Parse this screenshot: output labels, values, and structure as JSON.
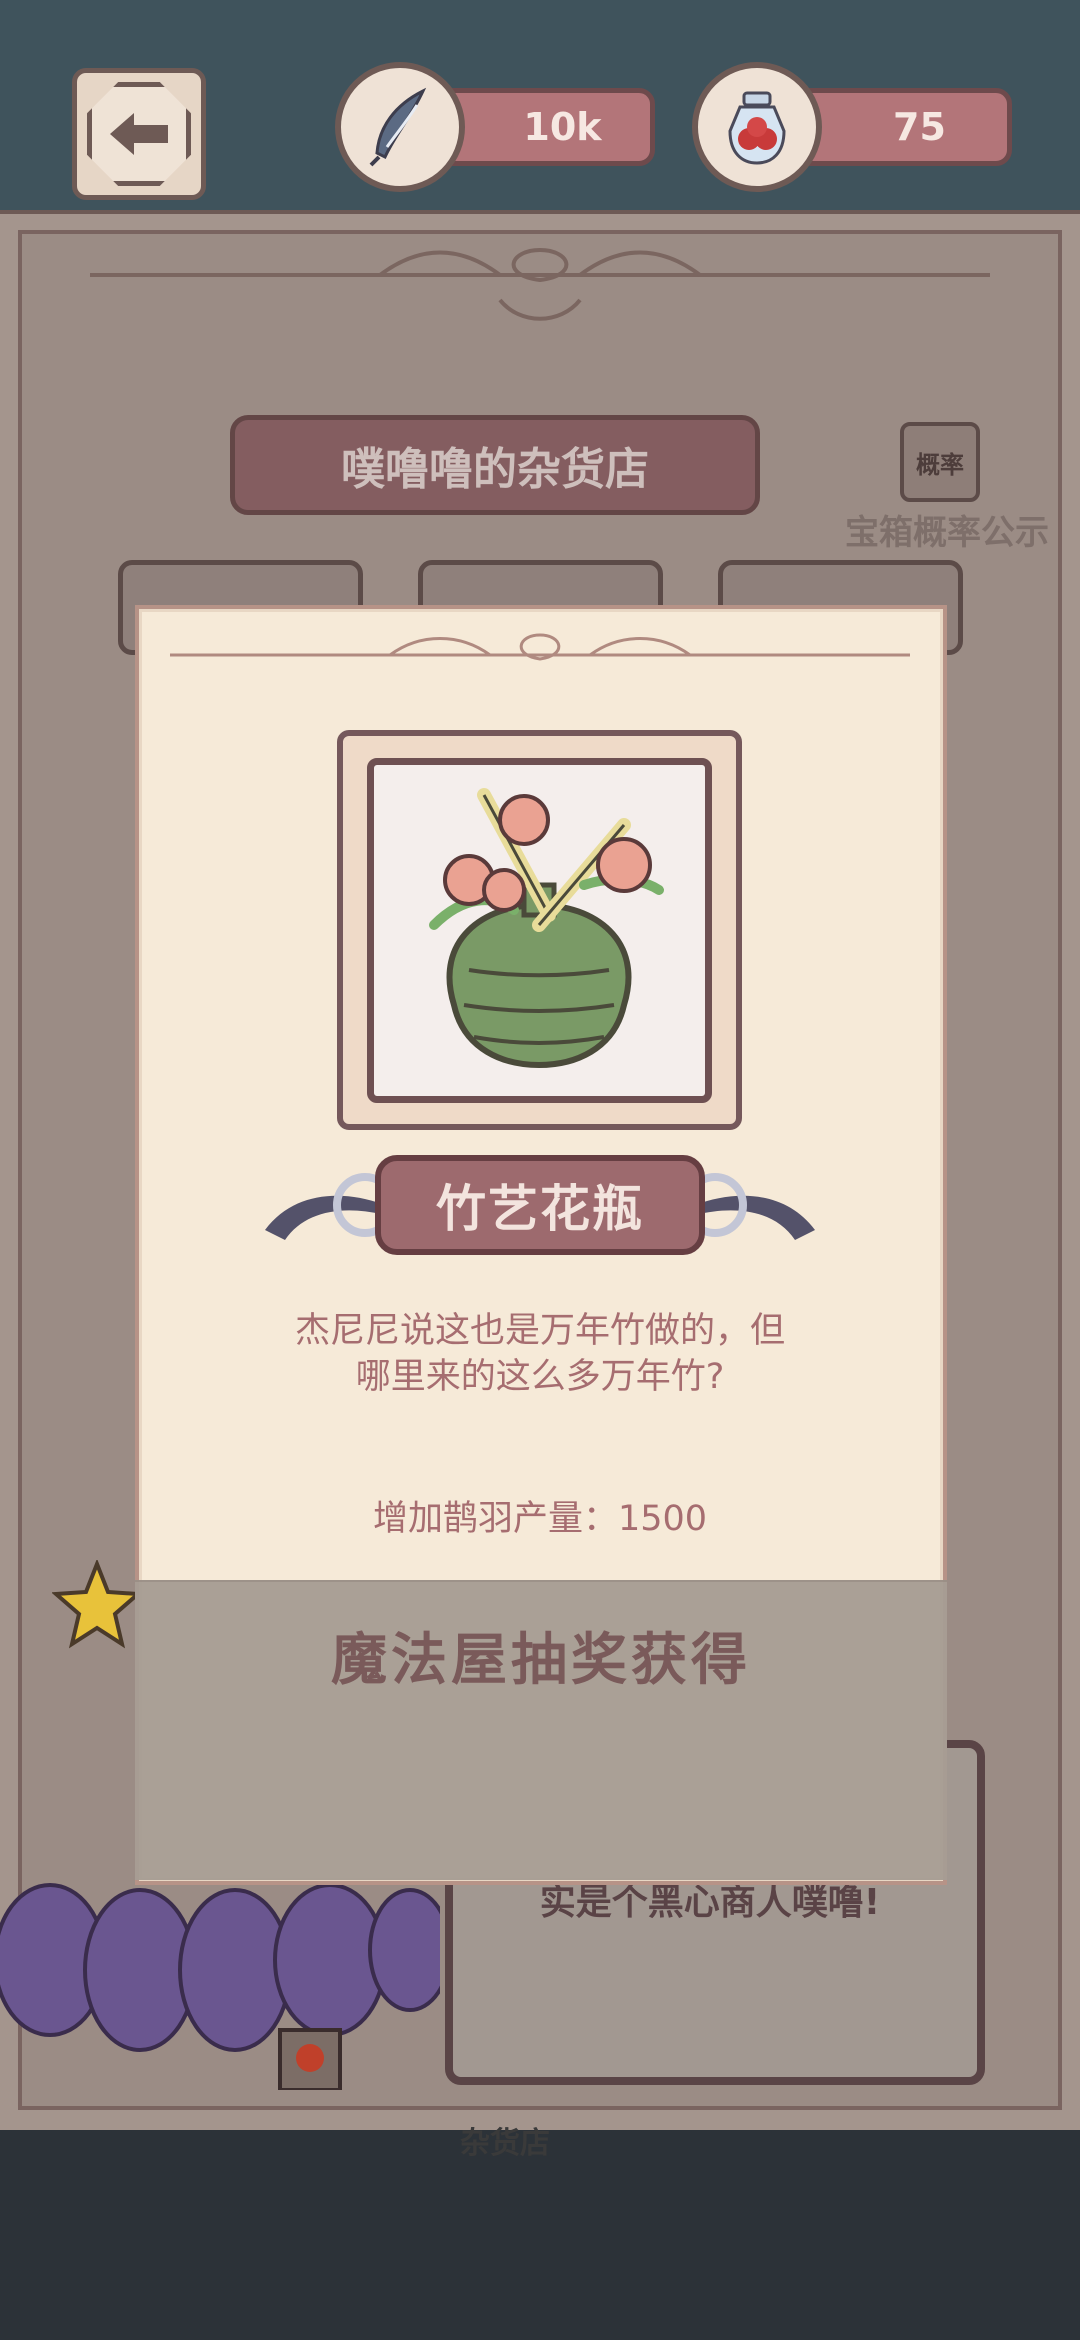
{
  "top_bar": {
    "back_icon": "arrow-left-icon",
    "feather": {
      "icon": "feather-icon",
      "value": "10k"
    },
    "jar": {
      "icon": "berry-jar-icon",
      "value": "75"
    }
  },
  "shop": {
    "title": "噗噜噜的杂货店",
    "probability_button": "概率",
    "probability_label": "宝箱概率公示",
    "npc_text": "实是个黑心商人噗噜!",
    "sign": "杂货店"
  },
  "popup": {
    "item_name": "竹艺花瓶",
    "description": "杰尼尼说这也是万年竹做的，但哪里来的这么多万年竹?",
    "effect": "增加鹊羽产量：1500",
    "source": "魔法屋抽奖获得",
    "item_icon": "bamboo-flower-vase-icon"
  },
  "colors": {
    "accent": "#9d6a6e",
    "panel": "#f6ead8",
    "topbar": "#3f535c"
  }
}
